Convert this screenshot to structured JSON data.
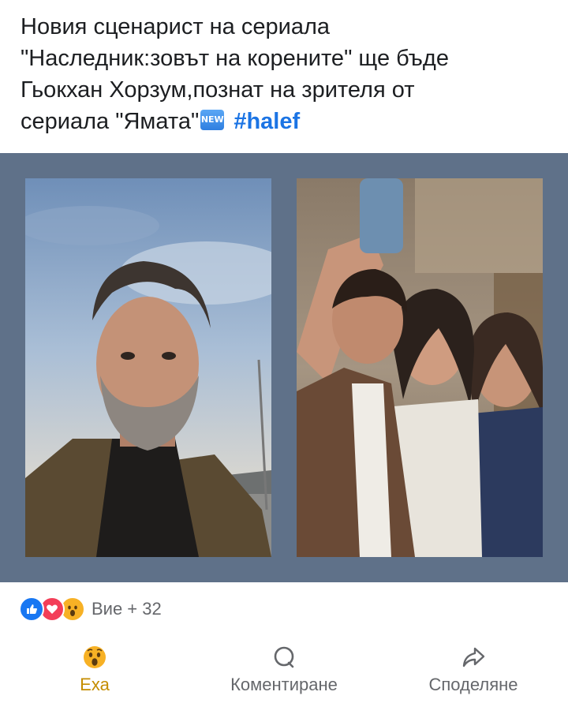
{
  "post": {
    "text_lines": [
      "Новия сценарист на сериала",
      "\"Наследник:зовът на корените\" ще бъде",
      "Гьокхан Хорзум,познат на зрителя от",
      "сериала \"Ямата\""
    ],
    "badge_label": "NEW",
    "hashtag": "#halef",
    "link_color": "#1b74e4"
  },
  "media": {
    "background_color": "#5f7189",
    "photos": [
      {
        "description": "Selfie of a man with curly grey hair and a beard under a cloudy sky"
      },
      {
        "description": "Selfie of a man and two smiling women inside a restaurant"
      }
    ]
  },
  "reactions": {
    "icons": [
      "like-icon",
      "love-icon",
      "wow-icon"
    ],
    "count_text": "Вие + 32"
  },
  "actions": {
    "react": {
      "label": "Еха",
      "icon": "wow-emoji-icon",
      "color": "#c58d00"
    },
    "comment": {
      "label": "Коментиране",
      "icon": "comment-bubble-icon"
    },
    "share": {
      "label": "Споделяне",
      "icon": "share-arrow-icon"
    }
  }
}
